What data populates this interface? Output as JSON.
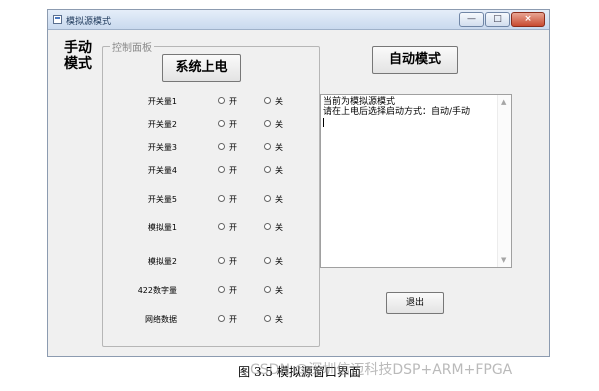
{
  "window": {
    "title": "模拟源模式",
    "controls": {
      "minimize": "—",
      "maximize": "□",
      "close": "×"
    }
  },
  "mode_label": "手动模式",
  "control_panel": {
    "title": "控制面板",
    "power_button": "系统上电",
    "on_label": "开",
    "off_label": "关",
    "rows": [
      {
        "label": "开关量1"
      },
      {
        "label": "开关量2"
      },
      {
        "label": "开关量3"
      },
      {
        "label": "开关量4"
      },
      {
        "label": "开关量5"
      },
      {
        "label": "模拟量1"
      },
      {
        "label": "模拟量2"
      },
      {
        "label": "422数字量"
      },
      {
        "label": "网络数据"
      }
    ]
  },
  "auto_mode_button": "自动模式",
  "log": {
    "lines": [
      "当前为模拟源模式",
      "请在上电后选择启动方式：自动/手动"
    ]
  },
  "exit_button": "退出",
  "caption": "图 3.5  模拟源窗口界面",
  "watermark": "CSDN @深圳信迈科技DSP+ARM+FPGA",
  "colors": {
    "titlebar": "#c9d9ee",
    "window_bg": "#f0f0f0",
    "close_button": "#c84a31"
  }
}
